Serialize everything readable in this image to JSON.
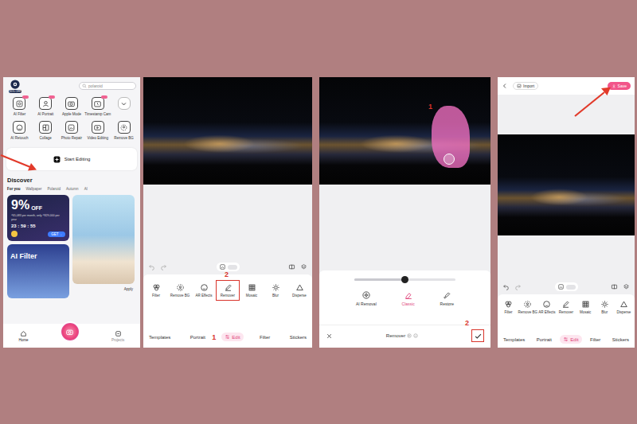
{
  "home": {
    "promo_badge": "35% OFF",
    "search": {
      "placeholder": "polaroid"
    },
    "tools": [
      {
        "label": "AI Filter",
        "badge": true
      },
      {
        "label": "AI Portrait",
        "badge": true
      },
      {
        "label": "Apple Mode",
        "badge": false
      },
      {
        "label": "Timestamp Cam",
        "badge": true
      },
      {
        "label": "AI Retouch",
        "badge": false
      },
      {
        "label": "Collage",
        "badge": false
      },
      {
        "label": "Photo Repair",
        "badge": false
      },
      {
        "label": "Video Editing",
        "badge": false
      },
      {
        "label": "Remove BG",
        "badge": false
      }
    ],
    "start_button": "Start Editing",
    "discover": {
      "title": "Discover",
      "tabs": [
        {
          "label": "For you",
          "selected": true
        },
        {
          "label": "Wallpaper",
          "selected": false
        },
        {
          "label": "Polaroid",
          "selected": false
        },
        {
          "label": "Autumn",
          "selected": false
        },
        {
          "label": "Al",
          "selected": false
        }
      ]
    },
    "promo": {
      "percent": "9%",
      "off": "OFF",
      "price": "₫65,083 per month, only ₫829,000 per year",
      "timer": "23 : 59 : 55",
      "button": "GET→"
    },
    "template_card": {
      "action": "Apply"
    },
    "filter_card": {
      "title": "AI Filter"
    },
    "nav": [
      {
        "label": "Home",
        "selected": true
      },
      {
        "label": "Projects",
        "selected": false
      }
    ]
  },
  "editor": {
    "tools": [
      {
        "label": "Filter",
        "selected": false
      },
      {
        "label": "Remove BG",
        "selected": false
      },
      {
        "label": "AR Effects",
        "selected": false
      },
      {
        "label": "Remover",
        "selected": true
      },
      {
        "label": "Mosaic",
        "selected": false
      },
      {
        "label": "Blur",
        "selected": false
      },
      {
        "label": "Disperse",
        "selected": false
      }
    ],
    "tabs": [
      {
        "label": "Templates",
        "selected": false
      },
      {
        "label": "Portrait",
        "selected": false
      },
      {
        "label": "Edit",
        "selected": true
      },
      {
        "label": "Filter",
        "selected": false
      },
      {
        "label": "Stickers",
        "selected": false
      }
    ],
    "annotations": {
      "tab": "1",
      "tool": "2"
    }
  },
  "remover": {
    "slider": {
      "level": 0.5
    },
    "modes": [
      {
        "label": "AI Removal",
        "selected": false
      },
      {
        "label": "Classic",
        "selected": true
      },
      {
        "label": "Restore",
        "selected": false
      }
    ],
    "title": "Remover",
    "annotations": {
      "brush": "1",
      "confirm": "2"
    }
  },
  "save_screen": {
    "import": "Import",
    "save": "Save",
    "tools": [
      {
        "label": "Filter",
        "selected": false
      },
      {
        "label": "Remove BG",
        "selected": false
      },
      {
        "label": "AR Effects",
        "selected": false
      },
      {
        "label": "Remover",
        "selected": false
      },
      {
        "label": "Mosaic",
        "selected": false
      },
      {
        "label": "Blur",
        "selected": false
      },
      {
        "label": "Disperse",
        "selected": false
      }
    ],
    "tabs": [
      {
        "label": "Templates",
        "selected": false
      },
      {
        "label": "Portrait",
        "selected": false
      },
      {
        "label": "Edit",
        "selected": true
      },
      {
        "label": "Filter",
        "selected": false
      },
      {
        "label": "Stickers",
        "selected": false
      }
    ]
  }
}
